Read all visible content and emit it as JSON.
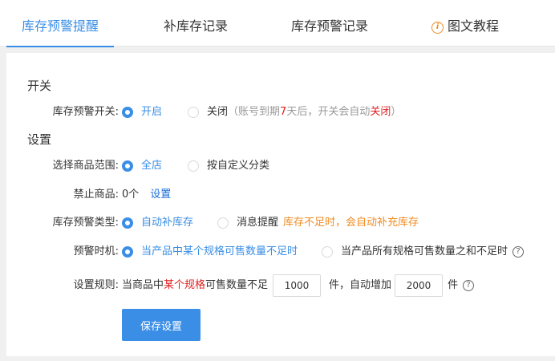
{
  "tabs": [
    {
      "label": "库存预警提醒"
    },
    {
      "label": "补库存记录"
    },
    {
      "label": "库存预警记录"
    },
    {
      "label": "图文教程",
      "icon": "info-icon"
    }
  ],
  "section_switch": {
    "title": "开关"
  },
  "switch_row": {
    "label": "库存预警开关:",
    "on_label": "开启",
    "off_label": "关闭",
    "note_prefix": "（账号到期",
    "note_days": "7",
    "note_mid": "天后，开关会自动",
    "note_closed": "关闭",
    "note_suffix": "）"
  },
  "section_settings": {
    "title": "设置"
  },
  "scope_row": {
    "label": "选择商品范围:",
    "opt_all": "全店",
    "opt_custom": "按自定义分类"
  },
  "banned_row": {
    "label": "禁止商品:",
    "count": "0个",
    "link": "设置"
  },
  "type_row": {
    "label": "库存预警类型:",
    "opt_auto": "自动补库存",
    "opt_msg": "消息提醒",
    "hint": "库存不足时，会自动补充库存"
  },
  "timing_row": {
    "label": "预警时机:",
    "opt_single": "当产品中某个规格可售数量不足时",
    "opt_all": "当产品所有规格可售数量之和不足时"
  },
  "rule_row": {
    "label": "设置规则:",
    "text1": "当商品中",
    "text_red": "某个规格",
    "text2": "可售数量不足",
    "threshold": "1000",
    "unit1": "件，自动增加",
    "increment": "2000",
    "unit2": "件"
  },
  "save_button": {
    "label": "保存设置"
  },
  "colors": {
    "accent": "#3a8ee6",
    "warning": "#f08c23",
    "danger": "#e02020"
  }
}
